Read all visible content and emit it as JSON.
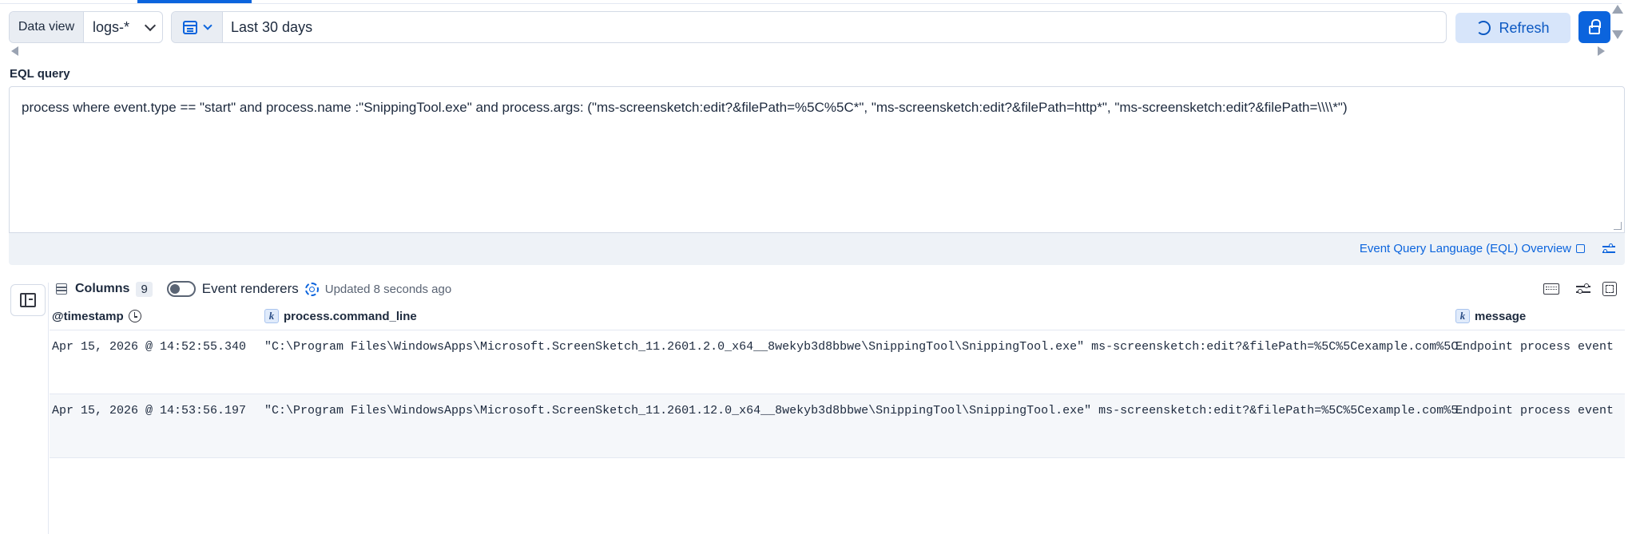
{
  "query_bar": {
    "data_view_label": "Data view",
    "data_view_value": "logs-*",
    "date_range": "Last 30 days",
    "refresh_label": "Refresh"
  },
  "eql": {
    "label": "EQL query",
    "query": "process where event.type == \"start\" and process.name :\"SnippingTool.exe\" and process.args: (\"ms-screensketch:edit?&filePath=%5C%5C*\", \"ms-screensketch:edit?&filePath=http*\", \"ms-screensketch:edit?&filePath=\\\\\\\\*\")",
    "overview_link": "Event Query Language (EQL) Overview"
  },
  "grid": {
    "columns_label": "Columns",
    "columns_count": "9",
    "renderers_label": "Event renderers",
    "updated_text": "Updated 8 seconds ago",
    "headers": {
      "timestamp": "@timestamp",
      "command_line": "process.command_line",
      "message": "message"
    },
    "rows": [
      {
        "timestamp": "Apr 15, 2026 @ 14:52:55.340",
        "command_line": "\"C:\\Program Files\\WindowsApps\\Microsoft.ScreenSketch_11.2601.2.0_x64__8wekyb3d8bbwe\\SnippingTool\\SnippingTool.exe\" ms-screensketch:edit?&filePath=%5C%5Cexample.com%5C…",
        "message": "Endpoint process event"
      },
      {
        "timestamp": "Apr 15, 2026 @ 14:53:56.197",
        "command_line": "\"C:\\Program Files\\WindowsApps\\Microsoft.ScreenSketch_11.2601.12.0_x64__8wekyb3d8bbwe\\SnippingTool\\SnippingTool.exe\" ms-screensketch:edit?&filePath=%5C%5Cexample.com%5…",
        "message": "Endpoint process event"
      }
    ]
  },
  "icons": {
    "calendar": "calendar-icon",
    "refresh": "refresh-icon",
    "lock": "lock-icon",
    "external": "external-link-icon"
  },
  "colors": {
    "accent": "#0b64dd",
    "refresh_bg": "#d7e5fa"
  }
}
